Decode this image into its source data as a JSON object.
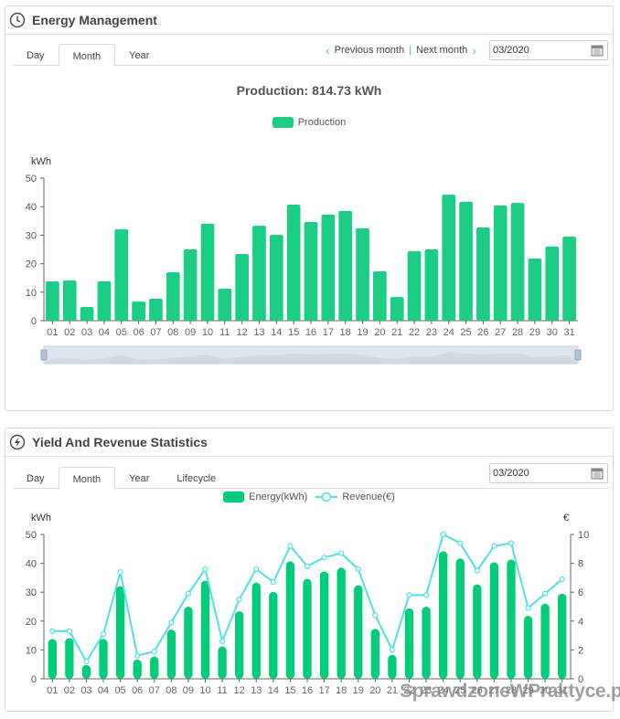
{
  "panel1": {
    "title": "Energy Management",
    "icon": "clock-icon",
    "tabs": [
      "Day",
      "Month",
      "Year"
    ],
    "active_tab": "Month",
    "prev": "Previous month",
    "next": "Next month",
    "date": "03/2020",
    "chart_title": "Production: 814.73 kWh"
  },
  "panel2": {
    "title": "Yield And Revenue Statistics",
    "icon": "lightning-icon",
    "tabs": [
      "Day",
      "Month",
      "Year",
      "Lifecycle"
    ],
    "active_tab": "Month",
    "date": "03/2020"
  },
  "watermark": "SprawdzoneWPraktyce.pl",
  "colors": {
    "bar": "#1ccd86",
    "bar2": "#00cc7a",
    "line": "#4fe0e8",
    "slider": "#d5dce6"
  },
  "chart_data": [
    {
      "type": "bar",
      "title": "Production: 814.73 kWh",
      "ylabel": "kWh",
      "legend": [
        "Production"
      ],
      "legend_position": "top",
      "ylim": [
        0,
        50
      ],
      "yticks": [
        0,
        10,
        20,
        30,
        40,
        50
      ],
      "categories": [
        "01",
        "02",
        "03",
        "04",
        "05",
        "06",
        "07",
        "08",
        "09",
        "10",
        "11",
        "12",
        "13",
        "14",
        "15",
        "16",
        "17",
        "18",
        "19",
        "20",
        "21",
        "22",
        "23",
        "24",
        "25",
        "26",
        "27",
        "28",
        "29",
        "30",
        "31"
      ],
      "values": [
        13.8,
        14.1,
        4.8,
        13.8,
        32.1,
        6.7,
        7.7,
        17.0,
        25.0,
        34.0,
        11.2,
        23.4,
        33.3,
        30.1,
        40.7,
        34.6,
        37.2,
        38.5,
        32.4,
        17.3,
        8.3,
        24.4,
        25.0,
        44.2,
        41.7,
        32.7,
        40.4,
        41.3,
        21.8,
        26.0,
        29.5
      ],
      "zoom_slider": true
    },
    {
      "type": "bar+line",
      "ylabel": "kWh",
      "y2label": "€",
      "ylim": [
        0,
        50
      ],
      "y2lim": [
        0,
        10
      ],
      "yticks": [
        0,
        10,
        20,
        30,
        40,
        50
      ],
      "y2ticks": [
        0,
        2,
        4,
        6,
        8,
        10
      ],
      "legend_position": "top",
      "categories": [
        "01",
        "02",
        "03",
        "04",
        "05",
        "06",
        "07",
        "08",
        "09",
        "10",
        "11",
        "12",
        "13",
        "14",
        "15",
        "16",
        "17",
        "18",
        "19",
        "20",
        "21",
        "22",
        "23",
        "24",
        "25",
        "26",
        "27",
        "28",
        "29",
        "30",
        "31"
      ],
      "series": [
        {
          "name": "Energy(kWh)",
          "type": "bar",
          "values": [
            13.8,
            14.1,
            4.8,
            13.8,
            32.1,
            6.7,
            7.7,
            17.0,
            25.0,
            34.0,
            11.2,
            23.4,
            33.3,
            30.1,
            40.7,
            34.6,
            37.2,
            38.5,
            32.4,
            17.3,
            8.3,
            24.4,
            25.0,
            44.2,
            41.7,
            32.7,
            40.4,
            41.3,
            21.8,
            26.0,
            29.5
          ]
        },
        {
          "name": "Revenue(€)",
          "type": "line",
          "axis": "right",
          "values": [
            3.3,
            3.3,
            1.2,
            3.1,
            7.4,
            1.6,
            1.9,
            3.9,
            5.9,
            7.6,
            2.6,
            5.5,
            7.6,
            6.7,
            9.2,
            7.8,
            8.4,
            8.7,
            7.6,
            4.4,
            2.0,
            5.8,
            5.8,
            10.0,
            9.4,
            7.5,
            9.2,
            9.4,
            4.9,
            5.9,
            6.9
          ]
        }
      ]
    }
  ]
}
